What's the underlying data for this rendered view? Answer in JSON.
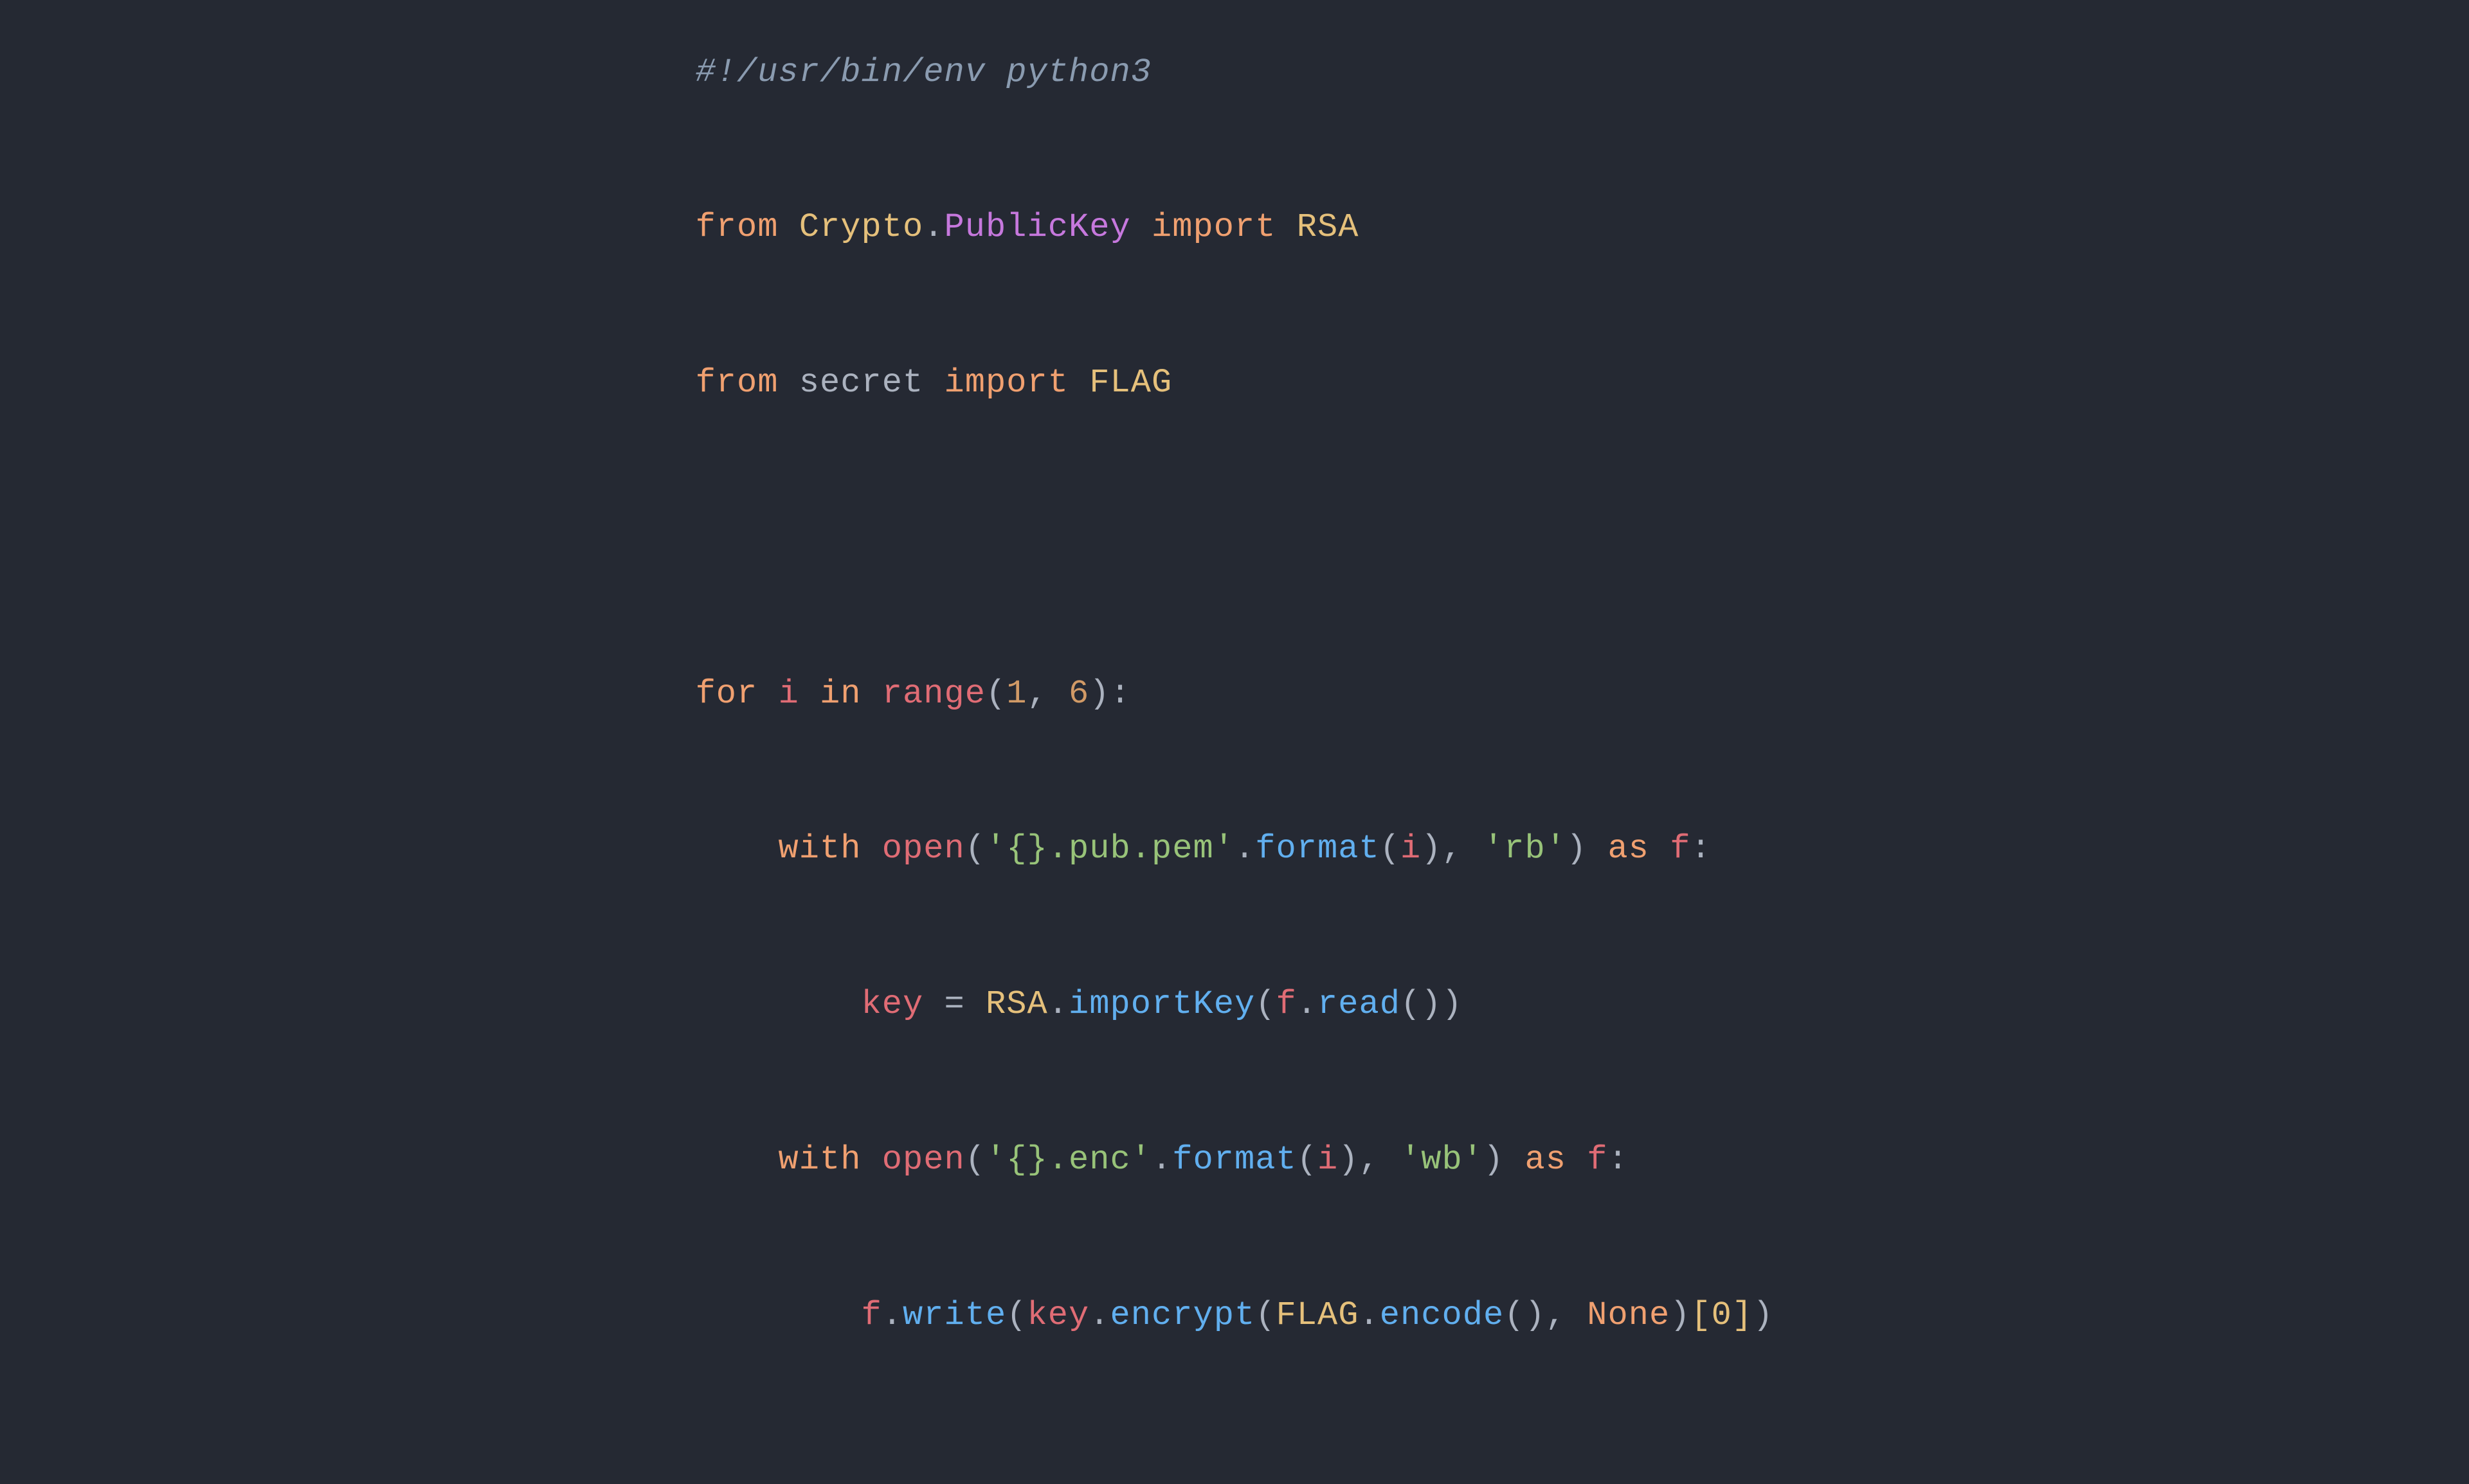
{
  "code": {
    "lines": [
      "#!/usr/bin/env python3",
      "from Crypto.PublicKey import RSA",
      "from secret import FLAG",
      "",
      "for i in range(1, 6):",
      "    with open('{}.pub.pem'.format(i), 'rb') as f:",
      "        key = RSA.importKey(f.read())",
      "    with open('{}.enc'.format(i), 'wb') as f:",
      "        f.write(key.encrypt(FLAG.encode(), None)[0])"
    ]
  }
}
